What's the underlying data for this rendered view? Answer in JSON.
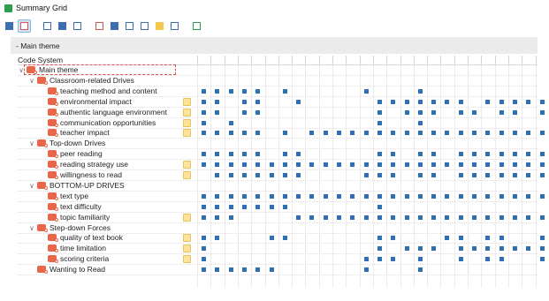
{
  "window": {
    "title": "Summary Grid"
  },
  "toolbar": {
    "buttons": [
      {
        "name": "filter-icon",
        "color": "#3d6fb0",
        "selected": false
      },
      {
        "name": "filter-active-icon",
        "color": "#d9534f",
        "selected": true
      },
      {
        "name": "layout-single-icon",
        "color": "#3d6fb0",
        "selected": false
      },
      {
        "name": "layout-split-icon",
        "color": "#3d6fb0",
        "selected": false
      },
      {
        "name": "layout-table-icon",
        "color": "#3d6fb0",
        "selected": false
      },
      {
        "name": "color-codes-icon",
        "color": "#d9534f",
        "selected": false
      },
      {
        "name": "code-relations-icon",
        "color": "#3d6fb0",
        "selected": false
      },
      {
        "name": "export-icon",
        "color": "#3d6fb0",
        "selected": false
      },
      {
        "name": "comment-icon",
        "color": "#3d6fb0",
        "selected": false
      },
      {
        "name": "memo-icon",
        "color": "#f2c94c",
        "selected": false
      },
      {
        "name": "text-format-icon",
        "color": "#3d6fb0",
        "selected": false
      },
      {
        "name": "spreadsheet-icon",
        "color": "#2e9e4d",
        "selected": false
      }
    ]
  },
  "section": {
    "label": "- Main theme"
  },
  "header": {
    "code_system": "Code System"
  },
  "colors": {
    "cell": "#2e6fb6",
    "code": "#e8664a",
    "memo": "#fde49a"
  },
  "rows": [
    {
      "label": "Main theme",
      "level": 0,
      "expander": "∨",
      "memo": false,
      "focused": true,
      "cells": []
    },
    {
      "label": "Classroom-related Drives",
      "level": 1,
      "expander": "∨",
      "memo": false,
      "cells": []
    },
    {
      "label": "teaching method and content",
      "level": 2,
      "expander": "",
      "memo": false,
      "cells": [
        1,
        2,
        3,
        4,
        5,
        7,
        13,
        17
      ]
    },
    {
      "label": "environmental impact",
      "level": 2,
      "expander": "",
      "memo": true,
      "cells": [
        1,
        2,
        4,
        5,
        8,
        14,
        15,
        16,
        17,
        18,
        19,
        20,
        22,
        23,
        24,
        25,
        26,
        27
      ]
    },
    {
      "label": "authentic language environment",
      "level": 2,
      "expander": "",
      "memo": true,
      "cells": [
        1,
        2,
        4,
        5,
        14,
        16,
        17,
        18,
        20,
        21,
        23,
        24,
        26,
        27
      ]
    },
    {
      "label": "communication opportunities",
      "level": 2,
      "expander": "",
      "memo": true,
      "cells": [
        1,
        3,
        14,
        17,
        27
      ]
    },
    {
      "label": "teacher impact",
      "level": 2,
      "expander": "",
      "memo": true,
      "cells": [
        1,
        2,
        3,
        4,
        5,
        7,
        9,
        10,
        11,
        12,
        13,
        14,
        15,
        16,
        17,
        18,
        19,
        20,
        21,
        22,
        23,
        24,
        25,
        26,
        27
      ]
    },
    {
      "label": "Top-down Drives",
      "level": 1,
      "expander": "∨",
      "memo": false,
      "cells": []
    },
    {
      "label": "peer reading",
      "level": 2,
      "expander": "",
      "memo": false,
      "cells": [
        1,
        2,
        3,
        4,
        5,
        7,
        8,
        14,
        15,
        17,
        18,
        20,
        21,
        22,
        23,
        24,
        25,
        26,
        27
      ]
    },
    {
      "label": "reading strategy use",
      "level": 2,
      "expander": "",
      "memo": true,
      "cells": [
        1,
        2,
        3,
        4,
        5,
        6,
        7,
        8,
        9,
        10,
        11,
        12,
        13,
        14,
        15,
        16,
        17,
        18,
        19,
        20,
        21,
        22,
        23,
        24,
        25,
        26,
        27
      ]
    },
    {
      "label": "willingness to read",
      "level": 2,
      "expander": "",
      "memo": true,
      "cells": [
        2,
        3,
        4,
        5,
        6,
        7,
        8,
        13,
        14,
        15,
        17,
        18,
        20,
        21,
        22,
        23,
        24,
        25,
        26,
        27
      ]
    },
    {
      "label": "BOTTOM-UP DRIVES",
      "level": 1,
      "expander": "∨",
      "memo": false,
      "cells": []
    },
    {
      "label": "text type",
      "level": 2,
      "expander": "",
      "memo": false,
      "cells": [
        1,
        2,
        3,
        4,
        5,
        6,
        7,
        8,
        9,
        10,
        11,
        12,
        13,
        14,
        15,
        16,
        17,
        18,
        19,
        20,
        21,
        22,
        23,
        24,
        25,
        26,
        27
      ]
    },
    {
      "label": "text difficulty",
      "level": 2,
      "expander": "",
      "memo": false,
      "cells": [
        1,
        2,
        3,
        4,
        5,
        6,
        7,
        14
      ]
    },
    {
      "label": "topic familiarity",
      "level": 2,
      "expander": "",
      "memo": true,
      "cells": [
        1,
        2,
        3,
        8,
        9,
        10,
        11,
        12,
        13,
        14,
        15,
        16,
        17,
        18,
        19,
        20,
        21,
        22,
        23,
        24,
        25,
        26,
        27
      ]
    },
    {
      "label": "Step-down Forces",
      "level": 1,
      "expander": "∨",
      "memo": false,
      "cells": []
    },
    {
      "label": "quality of text book",
      "level": 2,
      "expander": "",
      "memo": true,
      "cells": [
        1,
        2,
        6,
        7,
        14,
        15,
        19,
        20,
        22,
        23,
        26,
        27
      ]
    },
    {
      "label": "time limitation",
      "level": 2,
      "expander": "",
      "memo": true,
      "cells": [
        1,
        14,
        16,
        17,
        18,
        20,
        21,
        22,
        23,
        24,
        25,
        26,
        27
      ]
    },
    {
      "label": "scoring criteria",
      "level": 2,
      "expander": "",
      "memo": true,
      "cells": [
        1,
        13,
        14,
        15,
        17,
        20,
        22,
        23,
        26,
        27
      ]
    },
    {
      "label": "Wanting to Read",
      "level": 1,
      "expander": "",
      "memo": false,
      "cells": [
        1,
        2,
        3,
        4,
        5,
        6,
        13,
        17
      ]
    }
  ]
}
